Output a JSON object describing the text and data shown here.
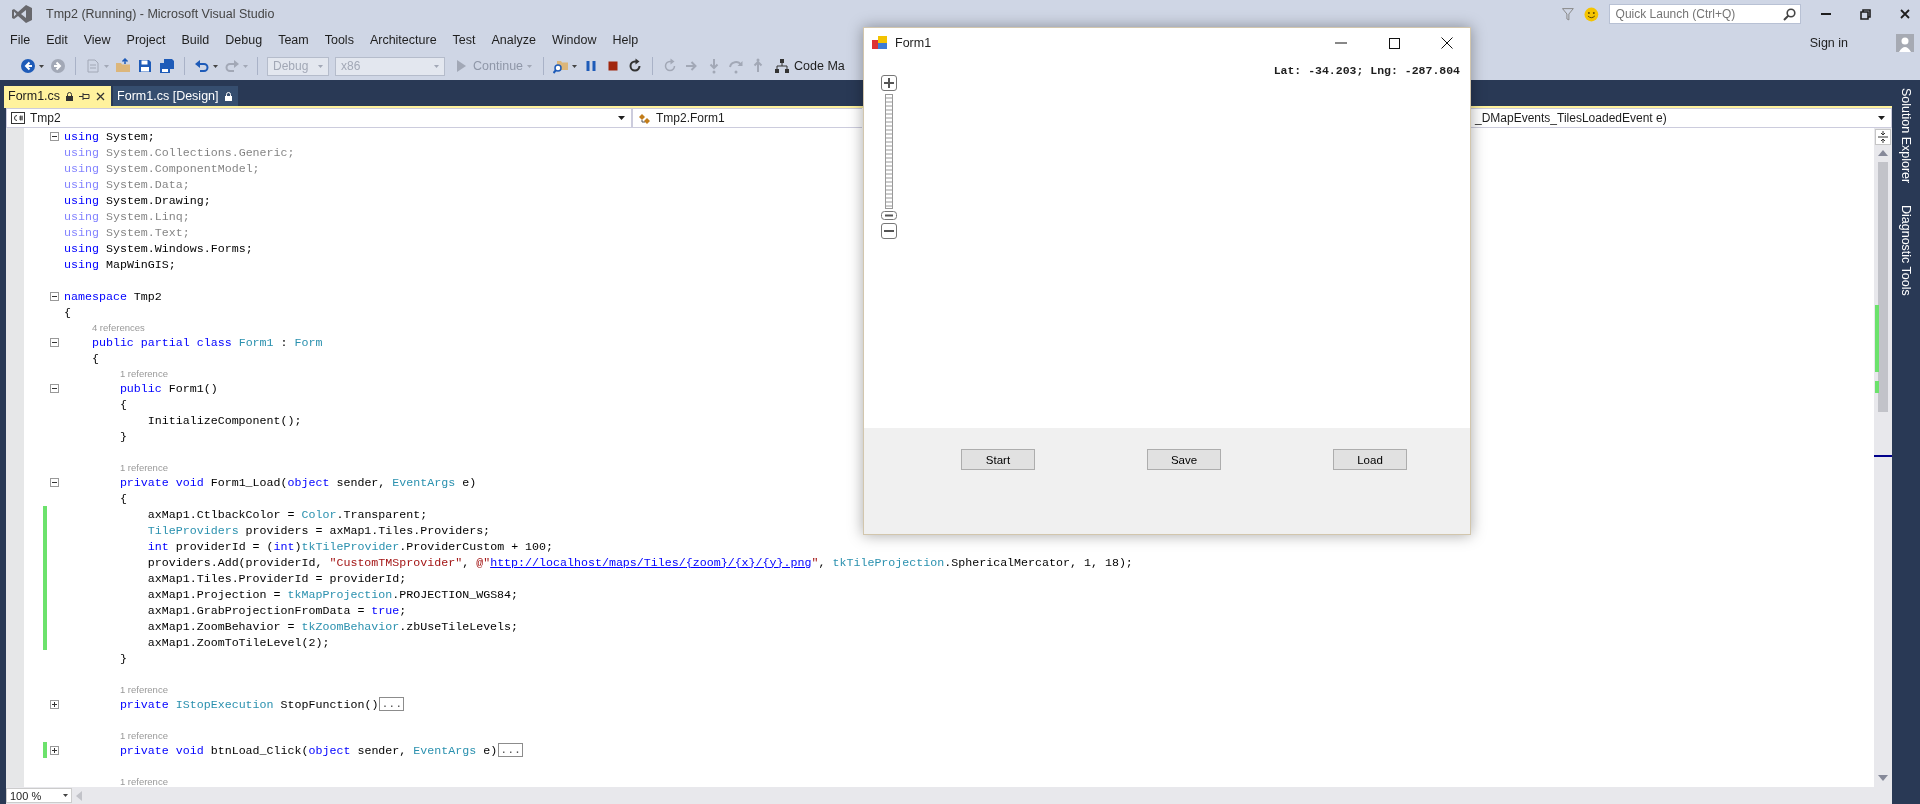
{
  "window": {
    "title": "Tmp2 (Running) - Microsoft Visual Studio"
  },
  "quick_launch": {
    "placeholder": "Quick Launch (Ctrl+Q)"
  },
  "sign_in": "Sign in",
  "menu": [
    "File",
    "Edit",
    "View",
    "Project",
    "Build",
    "Debug",
    "Team",
    "Tools",
    "Architecture",
    "Test",
    "Analyze",
    "Window",
    "Help"
  ],
  "toolbar": [
    {
      "kind": "back",
      "disabled": false,
      "dropdown": true
    },
    {
      "kind": "forward",
      "disabled": true,
      "dropdown": false
    },
    {
      "kind": "separator"
    },
    {
      "kind": "new",
      "disabled": true,
      "dropdown": true
    },
    {
      "kind": "open",
      "disabled": false,
      "dropdown": false
    },
    {
      "kind": "save",
      "disabled": false,
      "dropdown": false
    },
    {
      "kind": "save_all",
      "disabled": false,
      "dropdown": false
    },
    {
      "kind": "separator"
    },
    {
      "kind": "undo",
      "disabled": false,
      "dropdown": true
    },
    {
      "kind": "redo",
      "disabled": true,
      "dropdown": true
    },
    {
      "kind": "separator"
    },
    {
      "kind": "combo",
      "value": "Debug",
      "disabled": true
    },
    {
      "kind": "combo",
      "value": "x86",
      "disabled": true
    },
    {
      "kind": "continue",
      "label": "Continue",
      "disabled": true,
      "dropdown": true
    },
    {
      "kind": "separator"
    },
    {
      "kind": "folder_search",
      "disabled": false,
      "dropdown": true
    },
    {
      "kind": "pause",
      "disabled": false,
      "dropdown": false
    },
    {
      "kind": "stop",
      "disabled": false,
      "dropdown": false
    },
    {
      "kind": "restart",
      "disabled": false,
      "dropdown": false
    },
    {
      "kind": "separator"
    },
    {
      "kind": "refresh",
      "disabled": true,
      "dropdown": false
    },
    {
      "kind": "step_right",
      "disabled": true,
      "dropdown": false
    },
    {
      "kind": "step_into",
      "disabled": true,
      "dropdown": false
    },
    {
      "kind": "step_over",
      "disabled": true,
      "dropdown": false
    },
    {
      "kind": "step_out",
      "disabled": true,
      "dropdown": false
    },
    {
      "kind": "code_map",
      "label": "Code Ma",
      "disabled": false,
      "dropdown": false
    }
  ],
  "tabs": [
    {
      "label": "Form1.cs",
      "selected": true,
      "locked": true
    },
    {
      "label": "Form1.cs [Design]",
      "selected": false,
      "locked": true
    }
  ],
  "nav": [
    {
      "kind": "file",
      "text": "Tmp2"
    },
    {
      "kind": "class",
      "text": "Tmp2.Form1"
    },
    {
      "kind": "member",
      "text": "_DMapEvents_TilesLoadedEvent e)"
    }
  ],
  "code_lines": [
    {
      "kind": "code",
      "collapsed": false,
      "changed": false,
      "faded": false,
      "tokens": [
        {
          "kind": "kw",
          "text": "using"
        },
        {
          "kind": "plain",
          "text": " System;"
        }
      ]
    },
    {
      "kind": "code",
      "changed": false,
      "faded": true,
      "tokens": [
        {
          "kind": "kw",
          "text": "using"
        },
        {
          "kind": "plain",
          "text": " System.Collections.Generic;"
        }
      ]
    },
    {
      "kind": "code",
      "changed": false,
      "faded": true,
      "tokens": [
        {
          "kind": "kw",
          "text": "using"
        },
        {
          "kind": "plain",
          "text": " System.ComponentModel;"
        }
      ]
    },
    {
      "kind": "code",
      "changed": false,
      "faded": true,
      "tokens": [
        {
          "kind": "kw",
          "text": "using"
        },
        {
          "kind": "plain",
          "text": " System.Data;"
        }
      ]
    },
    {
      "kind": "code",
      "changed": false,
      "faded": false,
      "tokens": [
        {
          "kind": "kw",
          "text": "using"
        },
        {
          "kind": "plain",
          "text": " System.Drawing;"
        }
      ]
    },
    {
      "kind": "code",
      "changed": false,
      "faded": true,
      "tokens": [
        {
          "kind": "kw",
          "text": "using"
        },
        {
          "kind": "plain",
          "text": " System.Linq;"
        }
      ]
    },
    {
      "kind": "code",
      "changed": false,
      "faded": true,
      "tokens": [
        {
          "kind": "kw",
          "text": "using"
        },
        {
          "kind": "plain",
          "text": " System.Text;"
        }
      ]
    },
    {
      "kind": "code",
      "changed": false,
      "faded": false,
      "tokens": [
        {
          "kind": "kw",
          "text": "using"
        },
        {
          "kind": "plain",
          "text": " System.Windows.Forms;"
        }
      ]
    },
    {
      "kind": "code",
      "changed": false,
      "faded": false,
      "tokens": [
        {
          "kind": "kw",
          "text": "using"
        },
        {
          "kind": "plain",
          "text": " MapWinGIS;"
        }
      ]
    },
    {
      "kind": "blank"
    },
    {
      "kind": "code",
      "collapsed": false,
      "changed": false,
      "faded": false,
      "tokens": [
        {
          "kind": "kw",
          "text": "namespace"
        },
        {
          "kind": "plain",
          "text": " Tmp2"
        }
      ]
    },
    {
      "kind": "code",
      "changed": false,
      "faded": false,
      "tokens": [
        {
          "kind": "plain",
          "text": "{"
        }
      ],
      "children": [
        {
          "kind": "lens",
          "text": "4 references"
        },
        {
          "kind": "code",
          "collapsed": false,
          "changed": false,
          "faded": false,
          "tokens": [
            {
              "kind": "kw",
              "text": "public partial class "
            },
            {
              "kind": "type",
              "text": "Form1"
            },
            {
              "kind": "plain",
              "text": " : "
            },
            {
              "kind": "type",
              "text": "Form"
            }
          ]
        },
        {
          "kind": "code",
          "changed": false,
          "faded": false,
          "tokens": [
            {
              "kind": "plain",
              "text": "{"
            }
          ],
          "children": [
            {
              "kind": "lens",
              "text": "1 reference"
            },
            {
              "kind": "code",
              "collapsed": false,
              "changed": false,
              "faded": false,
              "tokens": [
                {
                  "kind": "kw",
                  "text": "public"
                },
                {
                  "kind": "plain",
                  "text": " Form1()"
                }
              ]
            },
            {
              "kind": "code",
              "changed": false,
              "faded": false,
              "tokens": [
                {
                  "kind": "plain",
                  "text": "{"
                }
              ],
              "children": [
                {
                  "kind": "code",
                  "changed": false,
                  "faded": false,
                  "tokens": [
                    {
                      "kind": "plain",
                      "text": "InitializeComponent();"
                    }
                  ]
                }
              ]
            },
            {
              "kind": "code",
              "changed": false,
              "faded": false,
              "tokens": [
                {
                  "kind": "plain",
                  "text": "}"
                }
              ]
            },
            {
              "kind": "blank"
            },
            {
              "kind": "lens",
              "text": "1 reference"
            },
            {
              "kind": "code",
              "collapsed": false,
              "changed": false,
              "faded": false,
              "tokens": [
                {
                  "kind": "kw",
                  "text": "private void"
                },
                {
                  "kind": "plain",
                  "text": " Form1_Load("
                },
                {
                  "kind": "kw",
                  "text": "object"
                },
                {
                  "kind": "plain",
                  "text": " sender, "
                },
                {
                  "kind": "type",
                  "text": "EventArgs"
                },
                {
                  "kind": "plain",
                  "text": " e)"
                }
              ]
            },
            {
              "kind": "code",
              "changed": false,
              "faded": false,
              "tokens": [
                {
                  "kind": "plain",
                  "text": "{"
                }
              ],
              "children": [
                {
                  "kind": "code",
                  "changed": true,
                  "faded": false,
                  "tokens": [
                    {
                      "kind": "plain",
                      "text": "axMap1.CtlbackColor = "
                    },
                    {
                      "kind": "type",
                      "text": "Color"
                    },
                    {
                      "kind": "plain",
                      "text": ".Transparent;"
                    }
                  ]
                },
                {
                  "kind": "code",
                  "changed": true,
                  "faded": false,
                  "tokens": [
                    {
                      "kind": "type",
                      "text": "TileProviders"
                    },
                    {
                      "kind": "plain",
                      "text": " providers = axMap1.Tiles.Providers;"
                    }
                  ]
                },
                {
                  "kind": "code",
                  "changed": true,
                  "faded": false,
                  "tokens": [
                    {
                      "kind": "kw",
                      "text": "int"
                    },
                    {
                      "kind": "plain",
                      "text": " providerId = ("
                    },
                    {
                      "kind": "kw",
                      "text": "int"
                    },
                    {
                      "kind": "plain",
                      "text": ")"
                    },
                    {
                      "kind": "type",
                      "text": "tkTileProvider"
                    },
                    {
                      "kind": "plain",
                      "text": ".ProviderCustom + 100;"
                    }
                  ]
                },
                {
                  "kind": "code",
                  "changed": true,
                  "faded": false,
                  "tokens": [
                    {
                      "kind": "plain",
                      "text": "providers.Add(providerId, "
                    },
                    {
                      "kind": "str",
                      "text": "\"CustomTMSprovider\""
                    },
                    {
                      "kind": "plain",
                      "text": ", "
                    },
                    {
                      "kind": "str",
                      "text": "@\""
                    },
                    {
                      "kind": "url",
                      "text": "http://localhost/maps/Tiles/{zoom}/{x}/{y}.png"
                    },
                    {
                      "kind": "str",
                      "text": "\""
                    },
                    {
                      "kind": "plain",
                      "text": ", "
                    },
                    {
                      "kind": "type",
                      "text": "tkTileProjection"
                    },
                    {
                      "kind": "plain",
                      "text": ".SphericalMercator, 1, 18);"
                    }
                  ]
                },
                {
                  "kind": "code",
                  "changed": true,
                  "faded": false,
                  "tokens": [
                    {
                      "kind": "plain",
                      "text": "axMap1.Tiles.ProviderId = providerId;"
                    }
                  ]
                },
                {
                  "kind": "code",
                  "changed": true,
                  "faded": false,
                  "tokens": [
                    {
                      "kind": "plain",
                      "text": "axMap1.Projection = "
                    },
                    {
                      "kind": "type",
                      "text": "tkMapProjection"
                    },
                    {
                      "kind": "plain",
                      "text": ".PROJECTION_WGS84;"
                    }
                  ]
                },
                {
                  "kind": "code",
                  "changed": true,
                  "faded": false,
                  "tokens": [
                    {
                      "kind": "plain",
                      "text": "axMap1.GrabProjectionFromData = "
                    },
                    {
                      "kind": "kw",
                      "text": "true"
                    },
                    {
                      "kind": "plain",
                      "text": ";"
                    }
                  ]
                },
                {
                  "kind": "code",
                  "changed": true,
                  "faded": false,
                  "tokens": [
                    {
                      "kind": "plain",
                      "text": "axMap1.ZoomBehavior = "
                    },
                    {
                      "kind": "type",
                      "text": "tkZoomBehavior"
                    },
                    {
                      "kind": "plain",
                      "text": ".zbUseTileLevels;"
                    }
                  ]
                },
                {
                  "kind": "code",
                  "changed": true,
                  "faded": false,
                  "tokens": [
                    {
                      "kind": "plain",
                      "text": "axMap1.ZoomToTileLevel(2);"
                    }
                  ]
                }
              ]
            },
            {
              "kind": "code",
              "changed": false,
              "faded": false,
              "tokens": [
                {
                  "kind": "plain",
                  "text": "}"
                }
              ]
            },
            {
              "kind": "blank"
            },
            {
              "kind": "lens",
              "text": "1 reference"
            },
            {
              "kind": "code",
              "collapsed": true,
              "collapsed_text": "...",
              "changed": false,
              "faded": false,
              "tokens": [
                {
                  "kind": "kw",
                  "text": "private "
                },
                {
                  "kind": "type",
                  "text": "IStopExecution"
                },
                {
                  "kind": "plain",
                  "text": " StopFunction()"
                }
              ]
            },
            {
              "kind": "blank"
            },
            {
              "kind": "lens",
              "text": "1 reference"
            },
            {
              "kind": "code",
              "collapsed": true,
              "collapsed_text": "...",
              "changed": true,
              "faded": false,
              "tokens": [
                {
                  "kind": "kw",
                  "text": "private void"
                },
                {
                  "kind": "plain",
                  "text": " btnLoad_Click("
                },
                {
                  "kind": "kw",
                  "text": "object"
                },
                {
                  "kind": "plain",
                  "text": " sender, "
                },
                {
                  "kind": "type",
                  "text": "EventArgs"
                },
                {
                  "kind": "plain",
                  "text": " e)"
                }
              ]
            },
            {
              "kind": "blank"
            },
            {
              "kind": "lens",
              "text": "1 reference"
            }
          ]
        }
      ]
    }
  ],
  "zoom_level": {
    "value": "100 %"
  },
  "side_tabs": [
    "Solution Explorer",
    "Diagnostic Tools"
  ],
  "form_window": {
    "title": "Form1",
    "coordinates": "Lat: -34.203; Lng: -287.804",
    "buttons": [
      "Start",
      "Save",
      "Load"
    ]
  }
}
